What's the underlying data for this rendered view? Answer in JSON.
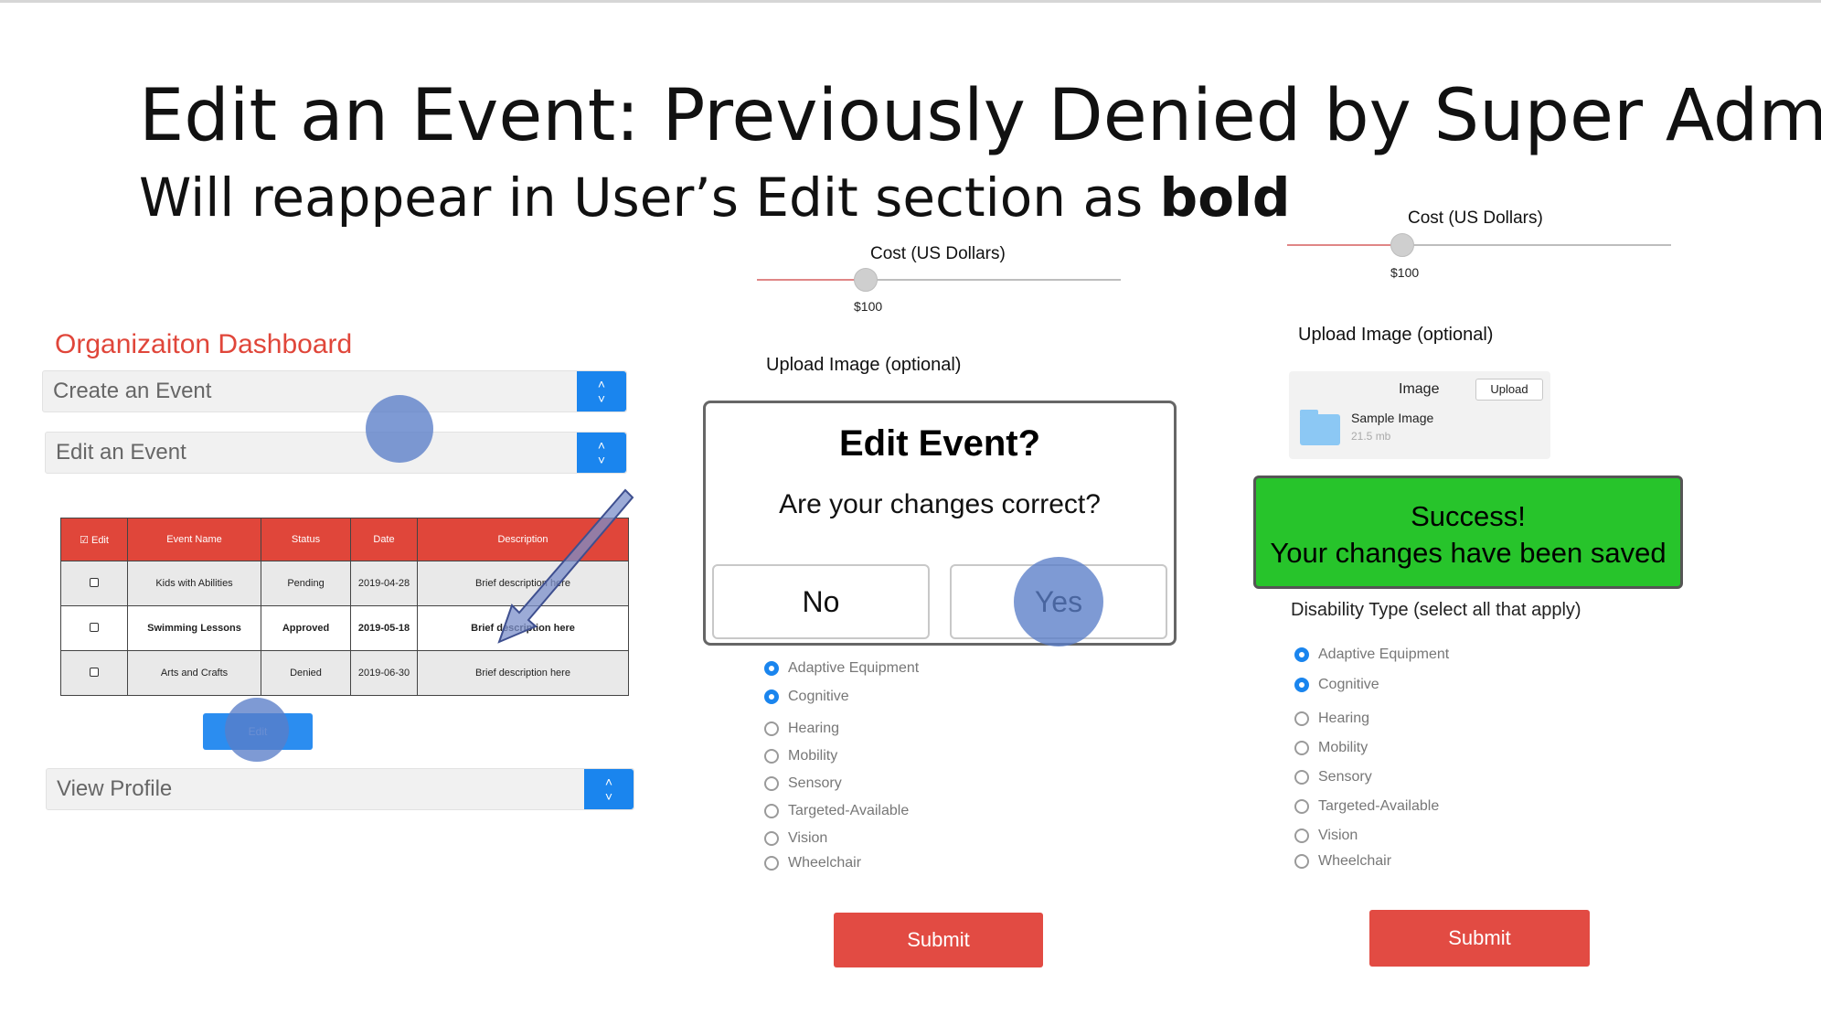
{
  "slide": {
    "title": "Edit an Event: Previously Denied by Super Admin",
    "subtitle_prefix": "Will reappear in User’s Edit section as ",
    "subtitle_bold": "bold"
  },
  "dashboard": {
    "title": "Organizaiton Dashboard",
    "create_event": "Create an Event",
    "edit_event": "Edit an Event",
    "view_profile": "View Profile",
    "spinner_up": "˄",
    "spinner_down": "˅",
    "table": {
      "columns": [
        "☑ Edit",
        "Event Name",
        "Status",
        "Date",
        "Description"
      ],
      "rows": [
        {
          "name": "Kids with Abilities",
          "status": "Pending",
          "date": "2019-04-28",
          "description": "Brief description here"
        },
        {
          "name": "Swimming Lessons",
          "status": "Approved",
          "date": "2019-05-18",
          "description": "Brief description here"
        },
        {
          "name": "Arts and Crafts",
          "status": "Denied",
          "date": "2019-06-30",
          "description": "Brief description here"
        }
      ]
    },
    "edit_button": "Edit"
  },
  "middle": {
    "cost_label": "Cost (US Dollars)",
    "cost_value": "$100",
    "cost_fraction": 0.3,
    "upload_label": "Upload Image (optional)",
    "modal": {
      "title": "Edit Event?",
      "question": "Are your changes correct?",
      "no": "No",
      "yes": "Yes"
    },
    "disabilities": [
      {
        "label": "Adaptive Equipment",
        "checked": true
      },
      {
        "label": "Cognitive",
        "checked": true
      },
      {
        "label": "Hearing",
        "checked": false
      },
      {
        "label": "Mobility",
        "checked": false
      },
      {
        "label": "Sensory",
        "checked": false
      },
      {
        "label": "Targeted-Available",
        "checked": false
      },
      {
        "label": "Vision",
        "checked": false
      },
      {
        "label": "Wheelchair",
        "checked": false
      }
    ],
    "submit": "Submit"
  },
  "right": {
    "cost_label": "Cost (US Dollars)",
    "cost_value": "$100",
    "cost_fraction": 0.3,
    "upload_label": "Upload Image (optional)",
    "image_label": "Image",
    "upload_button": "Upload",
    "file_name": "Sample Image",
    "file_size": "21.5 mb",
    "success_line1": "Success!",
    "success_line2": "Your changes have been saved",
    "disability_label": "Disability Type (select all that apply)",
    "disabilities": [
      {
        "label": "Adaptive Equipment",
        "checked": true
      },
      {
        "label": "Cognitive",
        "checked": true
      },
      {
        "label": "Hearing",
        "checked": false
      },
      {
        "label": "Mobility",
        "checked": false
      },
      {
        "label": "Sensory",
        "checked": false
      },
      {
        "label": "Targeted-Available",
        "checked": false
      },
      {
        "label": "Vision",
        "checked": false
      },
      {
        "label": "Wheelchair",
        "checked": false
      }
    ],
    "submit": "Submit"
  },
  "colors": {
    "accent_red": "#e0463a",
    "spinner_blue": "#1a85ee",
    "success_green": "#27c42b",
    "highlight_blob": "#5a7dc8"
  }
}
